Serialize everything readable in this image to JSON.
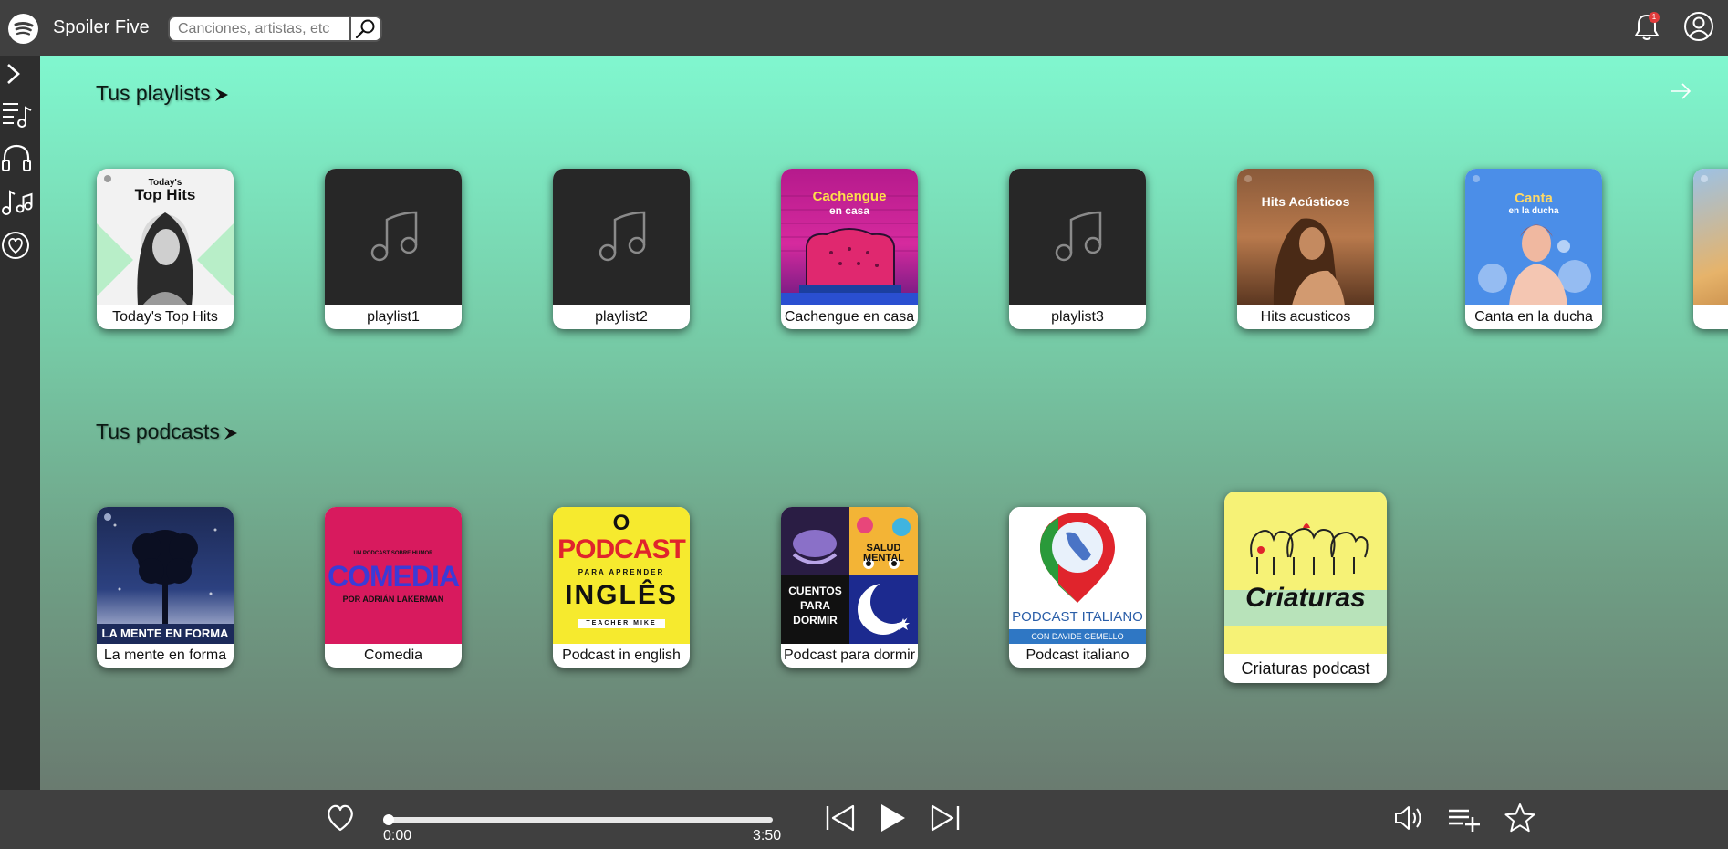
{
  "app": {
    "title": "Spoiler Five"
  },
  "search": {
    "placeholder": "Canciones, artistas, etc"
  },
  "notifications": {
    "count": "1"
  },
  "sections": {
    "playlists": {
      "title": "Tus playlists",
      "items": [
        {
          "label": "Today's Top Hits",
          "art_title": "Today's",
          "art_title2": "Top Hits"
        },
        {
          "label": "playlist1"
        },
        {
          "label": "playlist2"
        },
        {
          "label": "Cachengue en casa",
          "art_title": "Cachengue",
          "art_title2": "en casa"
        },
        {
          "label": "playlist3"
        },
        {
          "label": "Hits acusticos",
          "art_title": "Hits Acústicos"
        },
        {
          "label": "Canta en la ducha",
          "art_title": "Canta",
          "art_title2": "en la ducha"
        }
      ]
    },
    "podcasts": {
      "title": "Tus podcasts",
      "items": [
        {
          "label": "La mente en forma",
          "art_title": "LA MENTE EN FORMA"
        },
        {
          "label": "Comedia",
          "art_small": "UN PODCAST SOBRE HUMOR",
          "art_title": "COMEDIA",
          "art_sub": "POR ADRIÁN LAKERMAN"
        },
        {
          "label": "Podcast in english",
          "art_line1": "O",
          "art_line2": "PODCAST",
          "art_line3": "PARA APRENDER",
          "art_line4": "INGLÊS",
          "art_line5": "TEACHER MIKE"
        },
        {
          "label": "Podcast para dormir",
          "art_q1": "SALUD MENTAL",
          "art_q2": "CUENTOS PARA DORMIR"
        },
        {
          "label": "Podcast italiano",
          "art_title": "PODCAST ITALIANO",
          "art_sub": "CON DAVIDE GEMELLO"
        },
        {
          "label": "Criaturas podcast",
          "art_title": "Criaturas"
        }
      ]
    }
  },
  "player": {
    "current_time": "0:00",
    "total_time": "3:50",
    "progress": 0.0
  },
  "colors": {
    "topbar": "#404040",
    "sidebar": "#2e2e2e",
    "accent_green": "#80f7cf"
  },
  "icons": {
    "sidebar": [
      "chevron-right-icon",
      "queue-music-icon",
      "headphones-icon",
      "music-notes-icon",
      "heart-circle-icon"
    ],
    "player": [
      "heart-icon",
      "skip-previous-icon",
      "play-icon",
      "skip-next-icon",
      "volume-icon",
      "playlist-add-icon",
      "star-icon"
    ]
  }
}
